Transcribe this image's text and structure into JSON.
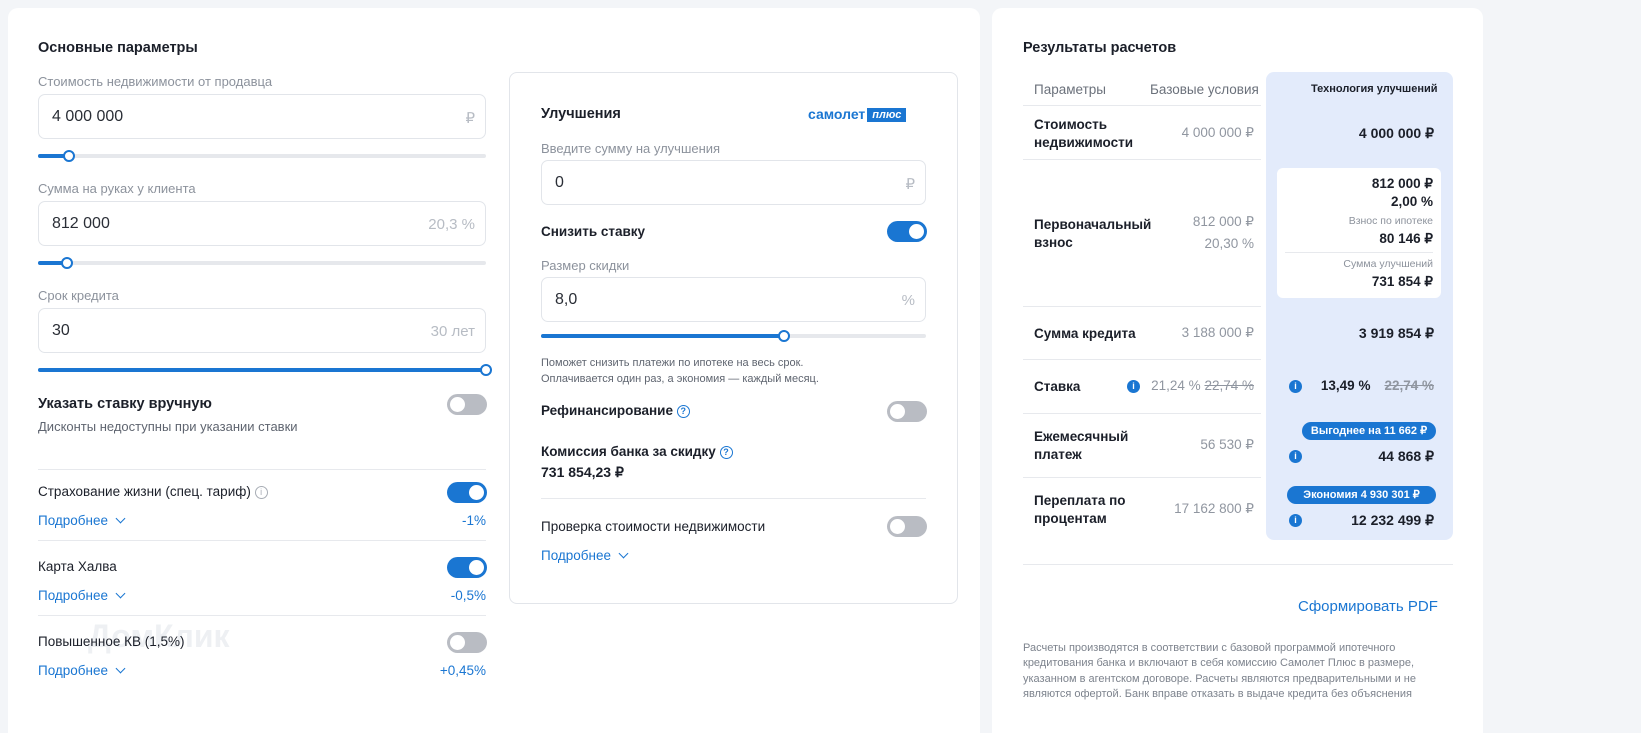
{
  "main": {
    "title": "Основные параметры",
    "price": {
      "label": "Стоимость недвижимости от продавца",
      "value": "4 000 000",
      "unit": "₽",
      "slider_level": 0.07
    },
    "cash": {
      "label": "Сумма на руках у клиента",
      "value": "812 000",
      "unit": "20,3 %",
      "slider_level": 0.065
    },
    "term": {
      "label": "Срок кредита",
      "value": "30",
      "unit": "30 лет",
      "slider_level": 1.0
    },
    "manual_rate": {
      "title": "Указать ставку вручную",
      "subtitle": "Дисконты недоступны при указании ставки",
      "on": false
    },
    "options": [
      {
        "label": "Страхование жизни (спец. тариф)",
        "more": "Подробнее",
        "value": "-1%",
        "on": true
      },
      {
        "label": "Карта Халва",
        "more": "Подробнее",
        "value": "-0,5%",
        "on": true
      },
      {
        "label": "Повышенное КВ (1,5%)",
        "more": "Подробнее",
        "value": "+0,45%",
        "on": false
      }
    ]
  },
  "improve": {
    "title": "Улучшения",
    "brand": "самолет",
    "brand_badge": "плюс",
    "sum_label": "Введите сумму на улучшения",
    "sum_value": "0",
    "sum_unit": "₽",
    "lower_rate": "Снизить ставку",
    "lower_rate_on": true,
    "discount_label": "Размер скидки",
    "discount_value": "8,0",
    "discount_unit": "%",
    "discount_level": 0.63,
    "hint1": "Поможет снизить платежи по ипотеке на весь срок.",
    "hint2": "Оплачивается один раз, а экономия — каждый месяц.",
    "refinance": "Рефинансирование",
    "refinance_on": false,
    "commission_label": "Комиссия банка за скидку",
    "commission_value": "731 854,23 ₽",
    "check": "Проверка стоимости недвижимости",
    "check_on": false,
    "more": "Подробнее"
  },
  "results": {
    "title": "Результаты расчетов",
    "headers": [
      "Параметры",
      "Базовые условия",
      "Технология улучшений"
    ],
    "rows": {
      "cost": {
        "label": "Стоимость недвижимости",
        "base": "4 000 000 ₽",
        "imp": "4 000 000 ₽"
      },
      "down": {
        "label": "Первоначальный взнос",
        "base1": "812 000 ₽",
        "base2": "20,30 %",
        "imp1": "812 000 ₽",
        "imp2": "2,00 %",
        "sub1_label": "Взнос по ипотеке",
        "sub1_value": "80 146 ₽",
        "sub2_label": "Сумма улучшений",
        "sub2_value": "731 854 ₽"
      },
      "loan": {
        "label": "Сумма кредита",
        "base": "3 188 000 ₽",
        "imp": "3 919 854 ₽"
      },
      "rate": {
        "label": "Ставка",
        "base": "21,24 %",
        "base_old": "22,74 %",
        "imp": "13,49 %",
        "imp_old": "22,74 %"
      },
      "monthly": {
        "label": "Ежемесячный платеж",
        "base": "56 530 ₽",
        "badge": "Выгоднее на 11 662 ₽",
        "imp": "44 868 ₽"
      },
      "overpay": {
        "label": "Переплата по процентам",
        "base": "17 162 800 ₽",
        "badge": "Экономия 4 930 301 ₽",
        "imp": "12 232 499 ₽"
      }
    },
    "pdf": "Сформировать PDF",
    "disclaimer": [
      "Расчеты производятся в соответствии с базовой программой ипотечного",
      "кредитования банка и включают в себя комиссию Самолет Плюс в размере,",
      "указанном в агентском договоре. Расчеты являются предварительными и не",
      "являются офертой. Банк вправе отказать в выдаче кредита без объяснения"
    ]
  },
  "watermark": "ДомКлик",
  "colors": {
    "accent": "#1a76d2",
    "highlight": "#e3ebfb"
  }
}
